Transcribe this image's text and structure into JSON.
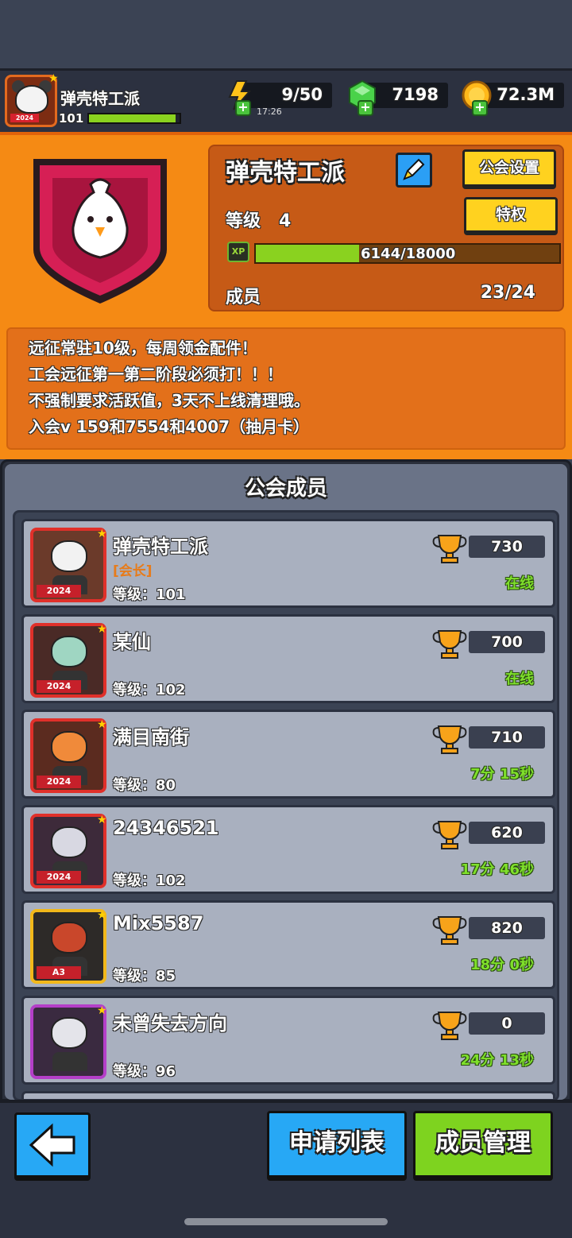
{
  "topbar": {
    "guild_name": "弹壳特工派",
    "player_level": "101",
    "avatar_year": "2024",
    "energy": "9/50",
    "energy_timer": "17:26",
    "gems": "7198",
    "gold": "72.3M",
    "player_level_fill": 0.96
  },
  "guild": {
    "name": "弹壳特工派",
    "settings_label": "公会设置",
    "privilege_label": "特权",
    "level_label": "等级",
    "level_value": "4",
    "xp_icon": "XP",
    "xp_text": "6144/18000",
    "xp_current": 6144,
    "xp_max": 18000,
    "members_label": "成员",
    "members_count": "23/24",
    "emblem_icon": "chicken-icon"
  },
  "notice": [
    "远征常驻10级，每周领金配件！",
    "工会远征第一第二阶段必须打！！！",
    "不强制要求活跃值，3天不上线清理哦。",
    "入会v 159和7554和4007（抽月卡）"
  ],
  "members_panel": {
    "title": "公会成员",
    "members": [
      {
        "name": "弹壳特工派",
        "role": "[会长]",
        "level": "等级：101",
        "score": "730",
        "status": "在线",
        "avatar_bg": "#6b3a2a",
        "head": "#f2f2f2",
        "border": "#e0302a",
        "year": "2024"
      },
      {
        "name": "某仙",
        "role": "",
        "level": "等级：102",
        "score": "700",
        "status": "在线",
        "avatar_bg": "#4a2a26",
        "head": "#9fd6c2",
        "border": "#e0302a",
        "year": "2024"
      },
      {
        "name": "满目南街",
        "role": "",
        "level": "等级：80",
        "score": "710",
        "status": "7分 15秒",
        "avatar_bg": "#5b2b1f",
        "head": "#f08a3a",
        "border": "#e0302a",
        "year": "2024"
      },
      {
        "name": "24346521",
        "role": "",
        "level": "等级：102",
        "score": "620",
        "status": "17分 46秒",
        "avatar_bg": "#3d2a3a",
        "head": "#d8d8e2",
        "border": "#e0302a",
        "year": "2024"
      },
      {
        "name": "Mix5587",
        "role": "",
        "level": "等级：85",
        "score": "820",
        "status": "18分 0秒",
        "avatar_bg": "#2d2a28",
        "head": "#c9472b",
        "border": "#f2b81a",
        "year": "A3"
      },
      {
        "name": "未曾失去方向",
        "role": "",
        "level": "等级：96",
        "score": "0",
        "status": "24分 13秒",
        "avatar_bg": "#3a2a40",
        "head": "#e4e4ea",
        "border": "#b43fc8",
        "year": ""
      }
    ]
  },
  "bottom": {
    "apply_list_label": "申请列表",
    "manage_label": "成员管理"
  },
  "colors": {
    "orange": "#f58a14",
    "green": "#8ad21f",
    "blue": "#27a8f5"
  }
}
